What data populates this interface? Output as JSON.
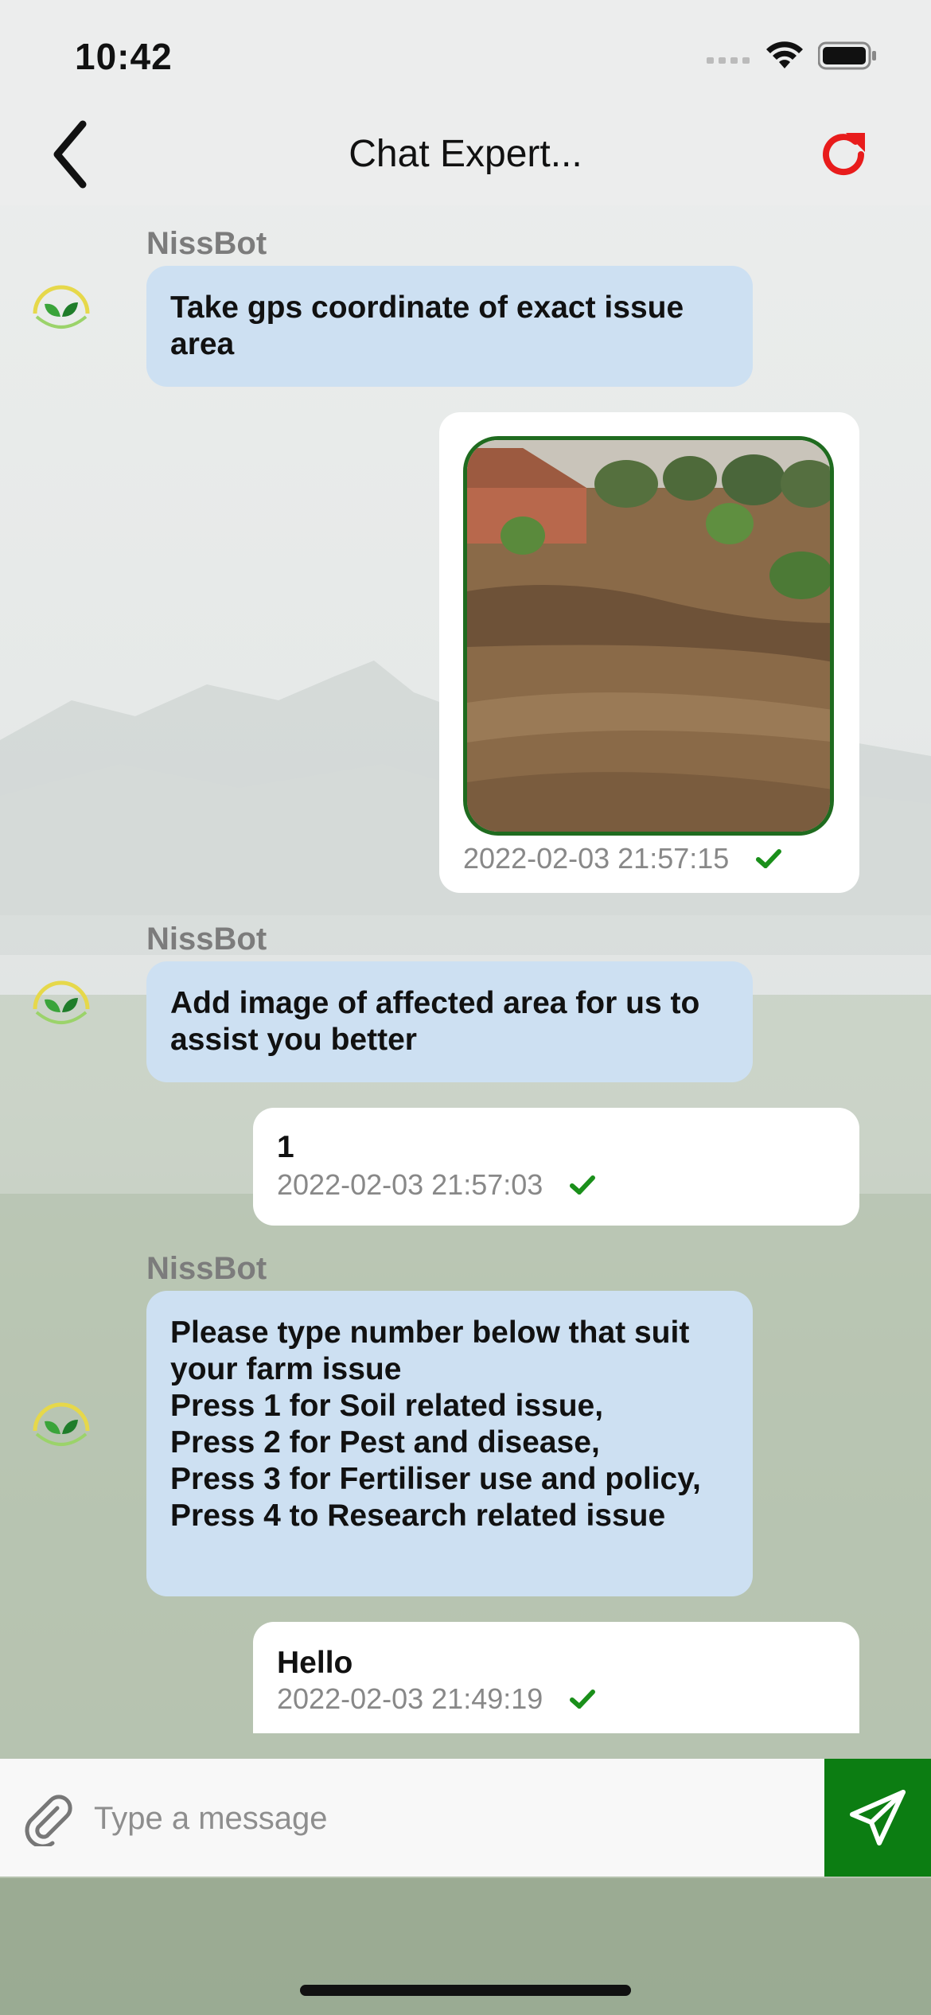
{
  "status_bar": {
    "time": "10:42"
  },
  "nav": {
    "title": "Chat Expert...",
    "back_icon": "chevron-left-icon",
    "refresh_icon": "refresh-icon"
  },
  "colors": {
    "bot_bubble": "#cde0f2",
    "user_bubble": "#ffffff",
    "accent_green": "#0c7d12",
    "refresh_red": "#e81c1c",
    "check_green": "#1a8f1a"
  },
  "messages": [
    {
      "type": "bot",
      "sender": "NissBot",
      "text": "Take gps coordinate of exact issue area"
    },
    {
      "type": "user_image",
      "timestamp": "2022-02-03 21:57:15"
    },
    {
      "type": "bot",
      "sender": "NissBot",
      "text": "Add image of affected area for us to assist you better"
    },
    {
      "type": "user",
      "text": "1",
      "timestamp": "2022-02-03 21:57:03"
    },
    {
      "type": "bot",
      "sender": "NissBot",
      "text": "Please type number below that suit your farm issue\nPress 1 for Soil related issue,\nPress 2 for Pest and disease,\nPress 3 for Fertiliser use and policy,\nPress 4 to Research related issue"
    },
    {
      "type": "user",
      "text": "Hello",
      "timestamp": "2022-02-03 21:49:19"
    }
  ],
  "composer": {
    "placeholder": "Type a message",
    "attach_icon": "paperclip-icon",
    "send_icon": "send-icon"
  }
}
